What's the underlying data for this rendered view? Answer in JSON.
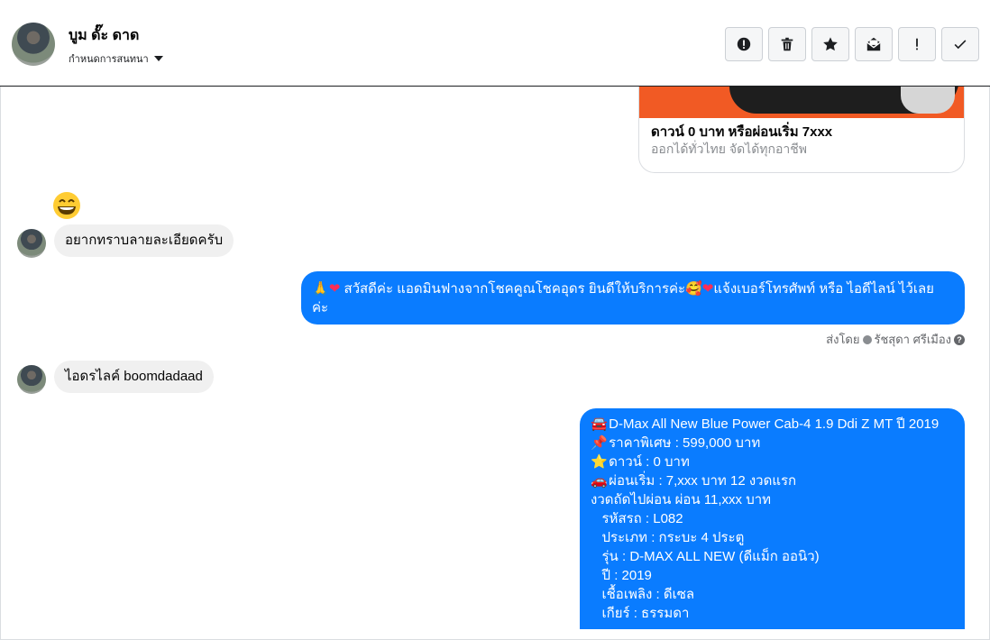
{
  "header": {
    "contact_name": "บูม ดั๊ะ ดาด",
    "status_label": "กำหนดการสนทนา",
    "actions": [
      {
        "name": "report-spam-button",
        "icon": "alert-circle-icon"
      },
      {
        "name": "delete-button",
        "icon": "trash-icon"
      },
      {
        "name": "star-button",
        "icon": "star-icon"
      },
      {
        "name": "mark-unread-button",
        "icon": "envelope-icon"
      },
      {
        "name": "follow-up-button",
        "icon": "exclamation-icon"
      },
      {
        "name": "mark-done-button",
        "icon": "check-icon"
      }
    ]
  },
  "card": {
    "title": "ดาวน์ 0 บาท หรือผ่อนเริ่ม 7xxx",
    "subtitle": "ออกได้ทั่วไทย จัดได้ทุกอาชีพ"
  },
  "messages": {
    "in1": "อยากทราบลายละเอียดครับ",
    "out1_line1": "สวัสดีค่ะ แอดมินฟางจากโชคคูณโชคอุดร ยินดีให้บริการค่ะ",
    "out1_line1b": "แจ้งเบอร์โทรศัพท์ หรือ ไอดีไลน์  ไว้เลย",
    "out1_line2": "ค่ะ",
    "sent_by_prefix": "ส่งโดย",
    "sent_by_name": "รัชสุดา ศรีเมือง",
    "in2": "ไอดรไลค์ boomdadaad",
    "out2": [
      {
        "emoji": "🚘",
        "text": "D-Max All New Blue Power Cab-4 1.9 Ddi Z MT ปี 2019"
      },
      {
        "emoji": "📌",
        "text": "ราคาพิเศษ : 599,000 บาท"
      },
      {
        "emoji": "⭐",
        "text": "ดาวน์ : 0 บาท"
      },
      {
        "emoji": "🚗",
        "text": "ผ่อนเริ่ม : 7,xxx บาท 12 งวดแรก"
      },
      {
        "emoji": "",
        "text": "งวดถัดไปผ่อน ผ่อน 11,xxx บาท"
      },
      {
        "emoji": "",
        "text": "   รหัสรถ : L082"
      },
      {
        "emoji": "",
        "text": "   ประเภท : กระบะ 4 ประตู"
      },
      {
        "emoji": "",
        "text": "   รุ่น : D-MAX ALL NEW (ดีแม็ก ออนิว)"
      },
      {
        "emoji": "",
        "text": "   ปี : 2019"
      },
      {
        "emoji": "",
        "text": "   เชื้อเพลิง : ดีเซล"
      },
      {
        "emoji": "",
        "text": "   เกียร์ : ธรรมดา"
      }
    ]
  },
  "colors": {
    "outgoing_bubble": "#0a7cff",
    "incoming_bubble": "#f0f0f0",
    "card_image": "#f15a24"
  }
}
